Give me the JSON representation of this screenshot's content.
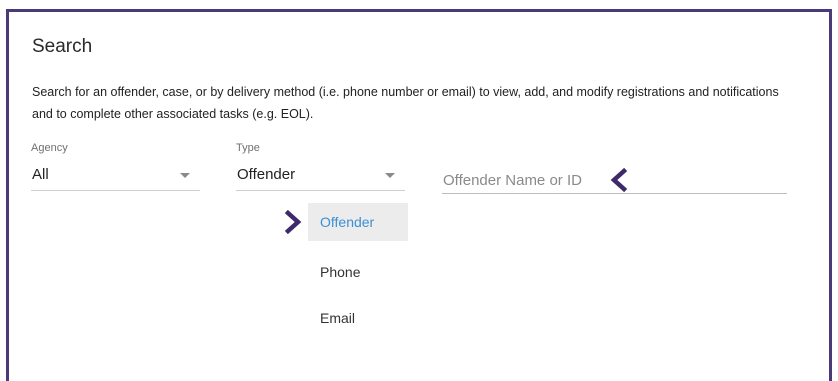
{
  "search": {
    "title": "Search",
    "description": "Search for an offender, case, or by delivery method (i.e. phone number or email) to view, add, and modify registrations and notifications and to complete other associated tasks (e.g. EOL).",
    "agency": {
      "label": "Agency",
      "value": "All"
    },
    "type": {
      "label": "Type",
      "value": "Offender",
      "options": [
        "Offender",
        "Phone",
        "Email"
      ],
      "selected_option": "Offender"
    },
    "query": {
      "placeholder": "Offender Name or ID",
      "value": ""
    }
  },
  "colors": {
    "frame_border": "#4b3a78",
    "annotation_arrow": "#3d2a6b",
    "selected_option_text": "#3d8fd3",
    "selected_option_bg": "#ececec"
  },
  "icons": {
    "annotation_left": "chevron-left-icon",
    "annotation_right": "chevron-right-icon",
    "select_caret": "caret-down-icon"
  }
}
